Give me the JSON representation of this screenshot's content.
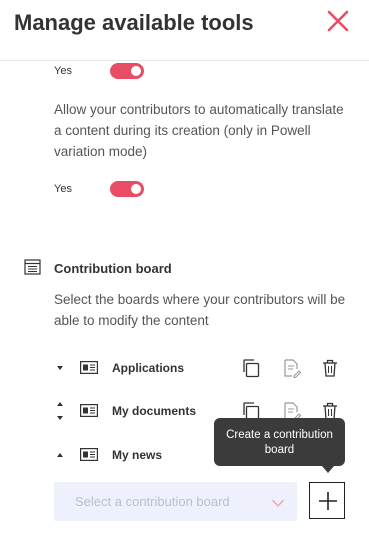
{
  "header": {
    "title": "Manage available tools"
  },
  "toggles": [
    {
      "label": "Yes",
      "on": true
    },
    {
      "label": "Yes",
      "on": true
    }
  ],
  "translate_desc": "Allow your contributors to automatically translate a content during its creation (only in Powell variation mode)",
  "contribution": {
    "title": "Contribution board",
    "desc": "Select the boards where your contributors will be able to modify the content",
    "boards": [
      {
        "name": "Applications"
      },
      {
        "name": "My documents"
      },
      {
        "name": "My news"
      }
    ],
    "select_placeholder": "Select a contribution board",
    "tooltip": "Create a contribution board"
  },
  "colors": {
    "accent": "#e94d65",
    "select_bg": "#eef1fb",
    "tooltip_bg": "#3b3b3b"
  }
}
